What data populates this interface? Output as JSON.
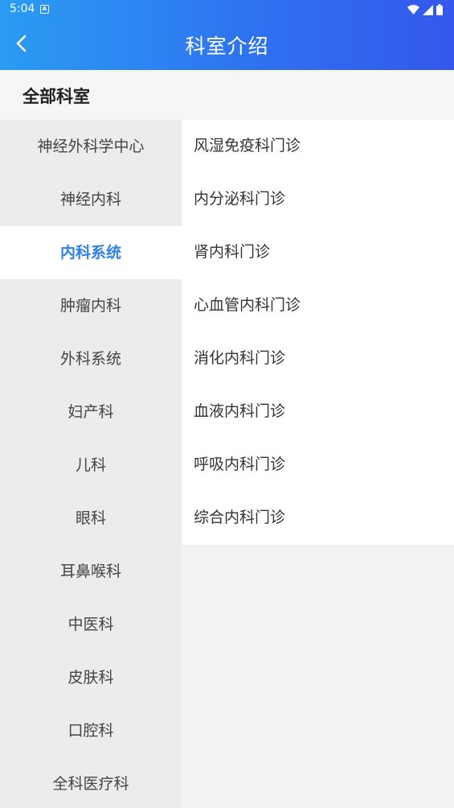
{
  "status_bar": {
    "time": "5:04",
    "notif_letter": "A"
  },
  "header": {
    "title": "科室介绍"
  },
  "section": {
    "title": "全部科室"
  },
  "left_menu": {
    "items": [
      {
        "label": "神经外科学中心"
      },
      {
        "label": "神经内科"
      },
      {
        "label": "内科系统",
        "active": true
      },
      {
        "label": "肿瘤内科"
      },
      {
        "label": "外科系统"
      },
      {
        "label": "妇产科"
      },
      {
        "label": "儿科"
      },
      {
        "label": "眼科"
      },
      {
        "label": "耳鼻喉科"
      },
      {
        "label": "中医科"
      },
      {
        "label": "皮肤科"
      },
      {
        "label": "口腔科"
      },
      {
        "label": "全科医疗科"
      }
    ]
  },
  "right_list": {
    "items": [
      {
        "label": "风湿免疫科门诊"
      },
      {
        "label": "内分泌科门诊"
      },
      {
        "label": "肾内科门诊"
      },
      {
        "label": "心血管内科门诊"
      },
      {
        "label": "消化内科门诊"
      },
      {
        "label": "血液内科门诊"
      },
      {
        "label": "呼吸内科门诊"
      },
      {
        "label": "综合内科门诊"
      }
    ]
  },
  "colors": {
    "header_start": "#2a9cf3",
    "header_end": "#3458ec",
    "active_text": "#2f80e8",
    "left_bg": "#ececec",
    "page_bg": "#f2f2f2"
  },
  "icons": [
    "back-arrow-icon",
    "notification-icon",
    "wifi-icon",
    "signal-icon",
    "battery-icon"
  ]
}
